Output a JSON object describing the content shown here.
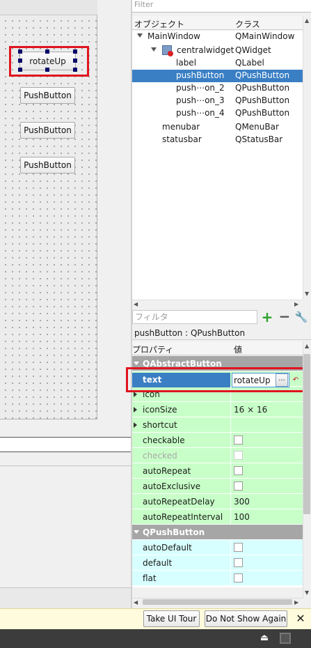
{
  "form": {
    "selected_button": "rotateUp",
    "buttons": [
      "PushButton",
      "PushButton",
      "PushButton"
    ]
  },
  "object_inspector": {
    "filter_placeholder": "Filter",
    "col_object": "オブジェクト",
    "col_class": "クラス",
    "rows": [
      {
        "name": "MainWindow",
        "class": "QMainWindow"
      },
      {
        "name": "centralwidget",
        "class": "QWidget"
      },
      {
        "name": "label",
        "class": "QLabel"
      },
      {
        "name": "pushButton",
        "class": "QPushButton"
      },
      {
        "name": "push⋯on_2",
        "class": "QPushButton"
      },
      {
        "name": "push⋯on_3",
        "class": "QPushButton"
      },
      {
        "name": "push⋯on_4",
        "class": "QPushButton"
      },
      {
        "name": "menubar",
        "class": "QMenuBar"
      },
      {
        "name": "statusbar",
        "class": "QStatusBar"
      }
    ]
  },
  "property_editor": {
    "filter_placeholder": "フィルタ",
    "title": "pushButton : QPushButton",
    "col_property": "プロパティ",
    "col_value": "値",
    "group_abstract": "QAbstractButton",
    "text_prop": "text",
    "text_value": "rotateUp",
    "dots": "...",
    "props": [
      {
        "name": "icon",
        "value": ""
      },
      {
        "name": "iconSize",
        "value": "16 × 16"
      },
      {
        "name": "shortcut",
        "value": ""
      },
      {
        "name": "checkable",
        "value": ""
      },
      {
        "name": "checked",
        "value": ""
      },
      {
        "name": "autoRepeat",
        "value": ""
      },
      {
        "name": "autoExclusive",
        "value": ""
      },
      {
        "name": "autoRepeatDelay",
        "value": "300"
      },
      {
        "name": "autoRepeatInterval",
        "value": "100"
      }
    ],
    "group_push": "QPushButton",
    "push_props": [
      {
        "name": "autoDefault"
      },
      {
        "name": "default"
      },
      {
        "name": "flat"
      }
    ]
  },
  "tour": {
    "take_tour": "Take UI Tour",
    "dont_show": "Do Not Show Again",
    "close": "✕"
  }
}
